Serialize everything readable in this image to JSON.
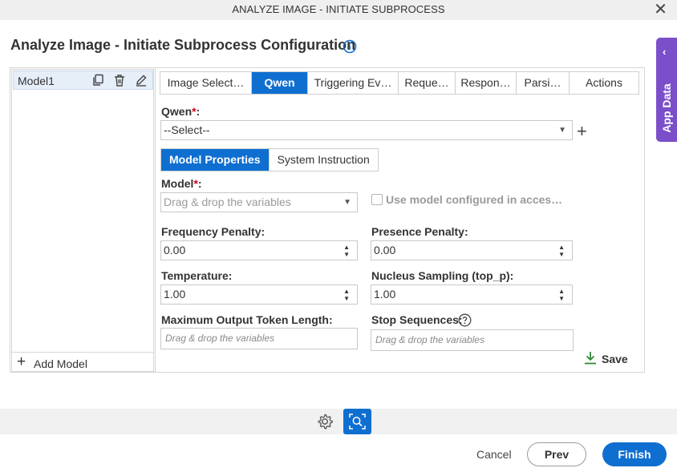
{
  "window": {
    "title": "ANALYZE IMAGE - INITIATE SUBPROCESS",
    "close_glyph": "✕"
  },
  "page": {
    "heading": "Analyze Image - Initiate Subprocess Configuration",
    "info_icon": "info-circle-icon"
  },
  "app_data": {
    "label": "App Data",
    "chevron": "‹"
  },
  "models": {
    "items": [
      {
        "label": "Model1"
      }
    ],
    "add_label": "Add Model",
    "item_icons": [
      "copy-icon",
      "trash-icon",
      "edit-icon"
    ]
  },
  "tabs": [
    {
      "label": "Image Select…",
      "active": false
    },
    {
      "label": "Qwen",
      "active": true
    },
    {
      "label": "Triggering Ev…",
      "active": false
    },
    {
      "label": "Reque…",
      "active": false
    },
    {
      "label": "Respon…",
      "active": false
    },
    {
      "label": "Parsi…",
      "active": false
    },
    {
      "label": "Actions",
      "active": false
    }
  ],
  "qwen": {
    "label": "Qwen",
    "required_mark": "*",
    "colon": ":",
    "value": "--Select--"
  },
  "subtabs": [
    {
      "label": "Model Properties",
      "active": true
    },
    {
      "label": "System Instruction",
      "active": false
    }
  ],
  "model": {
    "label": "Model",
    "required_mark": "*",
    "colon": ":",
    "placeholder": "Drag & drop the variables",
    "use_configured_label": "Use model configured in acces…"
  },
  "fields": {
    "frequency_penalty": {
      "label": "Frequency Penalty:",
      "value": "0.00"
    },
    "presence_penalty": {
      "label": "Presence Penalty:",
      "value": "0.00"
    },
    "temperature": {
      "label": "Temperature:",
      "value": "1.00"
    },
    "nucleus_sampling": {
      "label": "Nucleus Sampling (top_p):",
      "value": "1.00"
    },
    "max_output": {
      "label": "Maximum Output Token Length:",
      "placeholder": "Drag & drop the variables"
    },
    "stop_sequences": {
      "label": "Stop Sequences:",
      "placeholder": "Drag & drop the variables"
    }
  },
  "save_label": "Save",
  "footer": {
    "cancel": "Cancel",
    "prev": "Prev",
    "finish": "Finish"
  },
  "colors": {
    "accent": "#0f6fd1",
    "app_data": "#7b4fc9",
    "required": "#d0021b",
    "save_icon": "#2e8b3a"
  }
}
